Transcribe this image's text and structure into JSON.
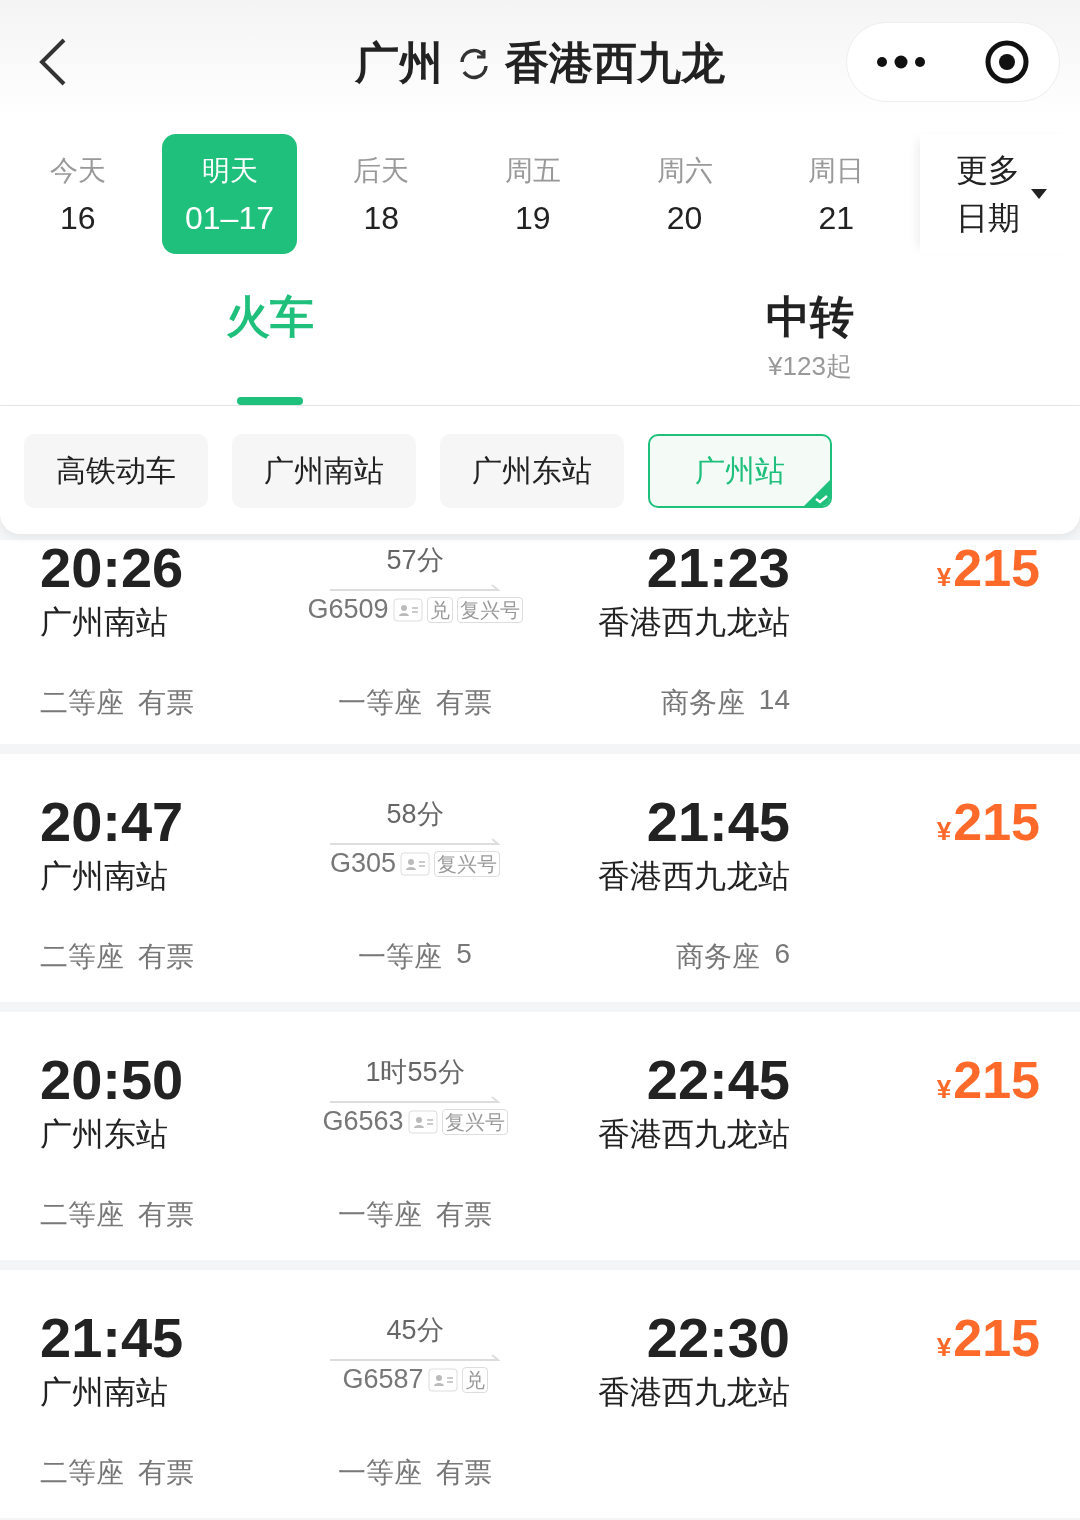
{
  "header": {
    "from": "广州",
    "to": "香港西九龙"
  },
  "dates": [
    {
      "label": "今天",
      "date": "16",
      "selected": false
    },
    {
      "label": "明天",
      "date": "01–17",
      "selected": true
    },
    {
      "label": "后天",
      "date": "18",
      "selected": false
    },
    {
      "label": "周五",
      "date": "19",
      "selected": false
    },
    {
      "label": "周六",
      "date": "20",
      "selected": false
    },
    {
      "label": "周日",
      "date": "21",
      "selected": false
    }
  ],
  "more_dates": [
    "更多",
    "日期"
  ],
  "modes": [
    {
      "label": "火车",
      "selected": true
    },
    {
      "label": "中转",
      "sub": "¥123起",
      "selected": false
    }
  ],
  "filters": [
    {
      "label": "高铁动车",
      "selected": false
    },
    {
      "label": "广州南站",
      "selected": false
    },
    {
      "label": "广州东站",
      "selected": false
    },
    {
      "label": "广州站",
      "selected": true
    }
  ],
  "trains": [
    {
      "depart": "20:26",
      "from": "广州南站",
      "duration": "57分",
      "number": "G6509",
      "tags": [
        {
          "kind": "icon"
        },
        {
          "kind": "text",
          "label": "兑"
        },
        {
          "kind": "text",
          "label": "复兴号"
        }
      ],
      "arrive": "21:23",
      "to": "香港西九龙站",
      "currency": "¥",
      "price": "215",
      "seats": [
        {
          "class": "二等座",
          "availability": "有票"
        },
        {
          "class": "一等座",
          "availability": "有票"
        },
        {
          "class": "商务座",
          "availability": "14"
        }
      ]
    },
    {
      "depart": "20:47",
      "from": "广州南站",
      "duration": "58分",
      "number": "G305",
      "tags": [
        {
          "kind": "icon"
        },
        {
          "kind": "text",
          "label": "复兴号"
        }
      ],
      "arrive": "21:45",
      "to": "香港西九龙站",
      "currency": "¥",
      "price": "215",
      "seats": [
        {
          "class": "二等座",
          "availability": "有票"
        },
        {
          "class": "一等座",
          "availability": "5"
        },
        {
          "class": "商务座",
          "availability": "6"
        }
      ]
    },
    {
      "depart": "20:50",
      "from": "广州东站",
      "duration": "1时55分",
      "number": "G6563",
      "tags": [
        {
          "kind": "icon"
        },
        {
          "kind": "text",
          "label": "复兴号"
        }
      ],
      "arrive": "22:45",
      "to": "香港西九龙站",
      "currency": "¥",
      "price": "215",
      "seats": [
        {
          "class": "二等座",
          "availability": "有票"
        },
        {
          "class": "一等座",
          "availability": "有票"
        }
      ]
    },
    {
      "depart": "21:45",
      "from": "广州南站",
      "duration": "45分",
      "number": "G6587",
      "tags": [
        {
          "kind": "icon"
        },
        {
          "kind": "text",
          "label": "兑"
        }
      ],
      "arrive": "22:30",
      "to": "香港西九龙站",
      "currency": "¥",
      "price": "215",
      "seats": [
        {
          "class": "二等座",
          "availability": "有票"
        },
        {
          "class": "一等座",
          "availability": "有票"
        }
      ]
    }
  ]
}
